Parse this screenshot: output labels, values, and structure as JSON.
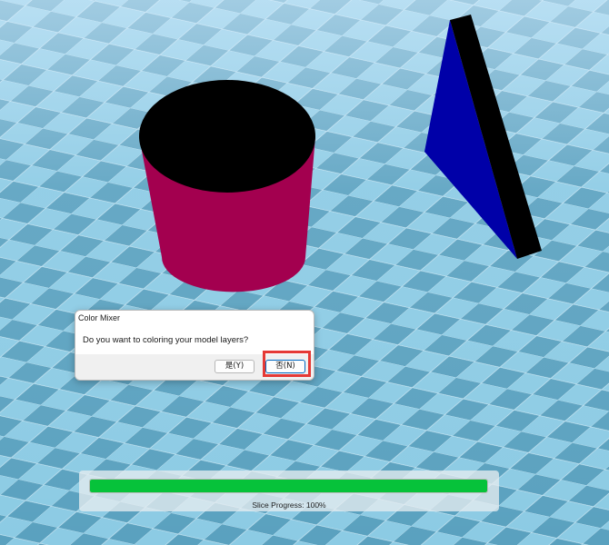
{
  "colors": {
    "floor_light": "#8ccbe4",
    "floor_dark": "#5aa1bf",
    "cylinder_side": "#a3004f",
    "cylinder_top": "#000000",
    "prism_face": "#0000a8",
    "prism_side": "#000000",
    "highlight": "#e53935",
    "progress_fill": "#06c23a"
  },
  "dialog": {
    "title": "Color Mixer",
    "message": "Do you want to coloring your model layers?",
    "yes_label": "是(Y)",
    "no_label": "否(N)"
  },
  "progress": {
    "label": "Slice Progress: 100%",
    "fraction": 1.0
  }
}
